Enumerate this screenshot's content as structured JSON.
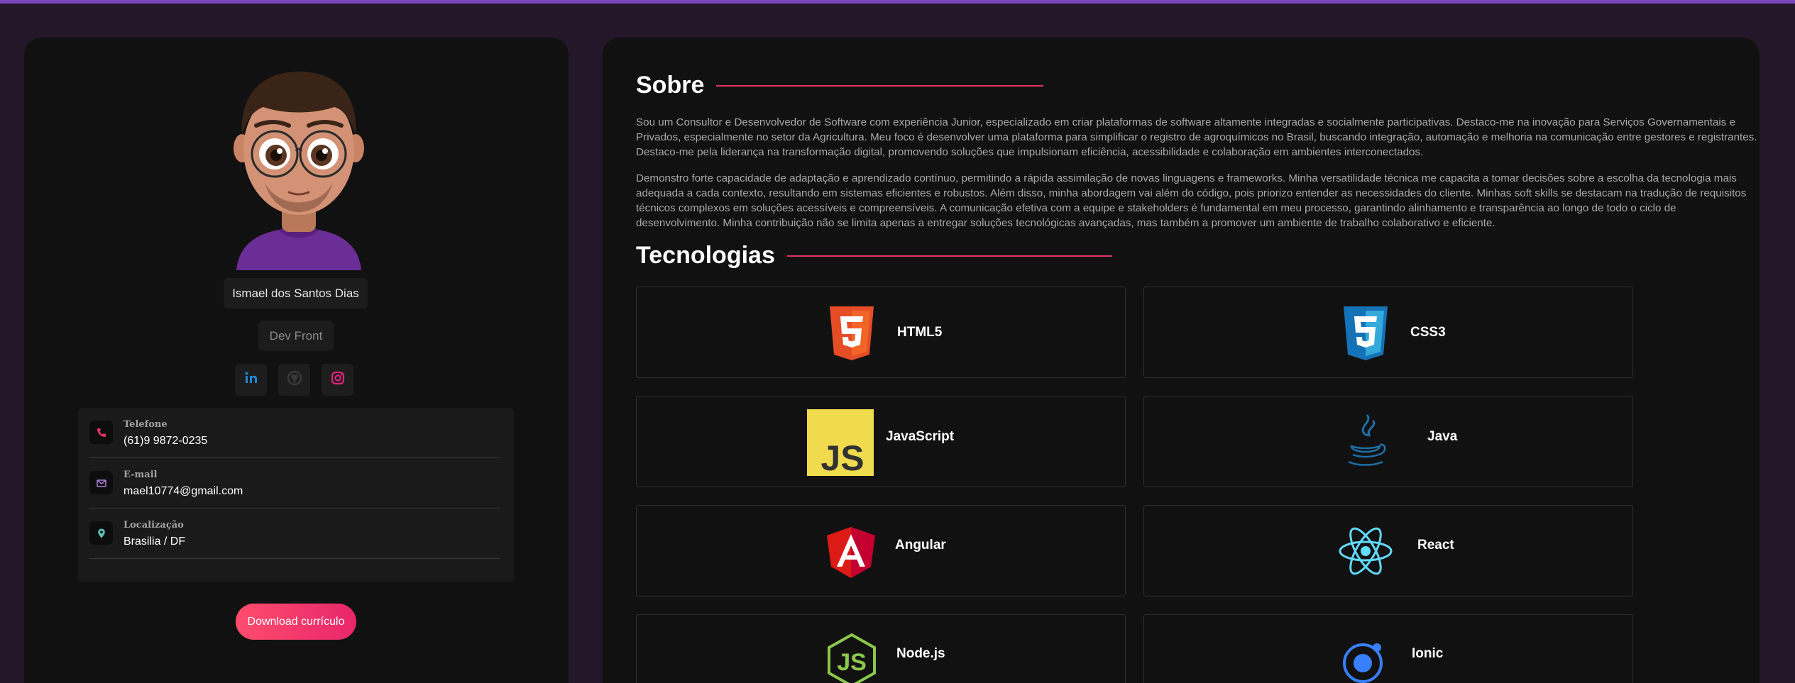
{
  "profile": {
    "name": "Ismael dos Santos Dias",
    "role": "Dev Front",
    "social": [
      "linkedin-icon",
      "github-icon",
      "instagram-icon"
    ],
    "contacts": [
      {
        "label": "Telefone",
        "value": "(61)9 9872-0235",
        "icon": "phone-icon"
      },
      {
        "label": "E-mail",
        "value": "mael10774@gmail.com",
        "icon": "mail-icon"
      },
      {
        "label": "Localização",
        "value": "Brasilia / DF",
        "icon": "location-pin-icon"
      }
    ],
    "download_label": "Download currículo"
  },
  "about": {
    "title": "Sobre",
    "paragraphs": [
      "Sou um Consultor e Desenvolvedor de Software com experiência Junior, especializado em criar plataformas de software altamente integradas e socialmente participativas. Destaco-me na inovação para Serviços Governamentais e Privados, especialmente no setor da Agricultura. Meu foco é desenvolver uma plataforma para simplificar o registro de agroquímicos no Brasil, buscando integração, automação e melhoria na comunicação entre gestores e registrantes. Destaco-me pela liderança na transformação digital, promovendo soluções que impulsionam eficiência, acessibilidade e colaboração em ambientes interconectados.",
      "Demonstro forte capacidade de adaptação e aprendizado contínuo, permitindo a rápida assimilação de novas linguagens e frameworks. Minha versatilidade técnica me capacita a tomar decisões sobre a escolha da tecnologia mais adequada a cada contexto, resultando em sistemas eficientes e robustos. Além disso, minha abordagem vai além do código, pois priorizo entender as necessidades do cliente. Minhas soft skills se destacam na tradução de requisitos técnicos complexos em soluções acessíveis e compreensíveis. A comunicação efetiva com a equipe e stakeholders é fundamental em meu processo, garantindo alinhamento e transparência ao longo de todo o ciclo de desenvolvimento. Minha contribuição não se limita apenas a entregar soluções tecnológicas avançadas, mas também a promover um ambiente de trabalho colaborativo e eficiente."
    ]
  },
  "tech": {
    "title": "Tecnologias",
    "items": [
      {
        "name": "HTML5",
        "icon": "html5-icon"
      },
      {
        "name": "CSS3",
        "icon": "css3-icon"
      },
      {
        "name": "JavaScript",
        "icon": "javascript-icon"
      },
      {
        "name": "Java",
        "icon": "java-icon"
      },
      {
        "name": "Angular",
        "icon": "angular-icon"
      },
      {
        "name": "React",
        "icon": "react-icon"
      },
      {
        "name": "Node.js",
        "icon": "nodejs-icon"
      },
      {
        "name": "Ionic",
        "icon": "ionic-icon"
      }
    ]
  },
  "colors": {
    "accent": "#e23563",
    "background": "#231729",
    "card": "#111111",
    "top_bar": "#7b47b8"
  }
}
